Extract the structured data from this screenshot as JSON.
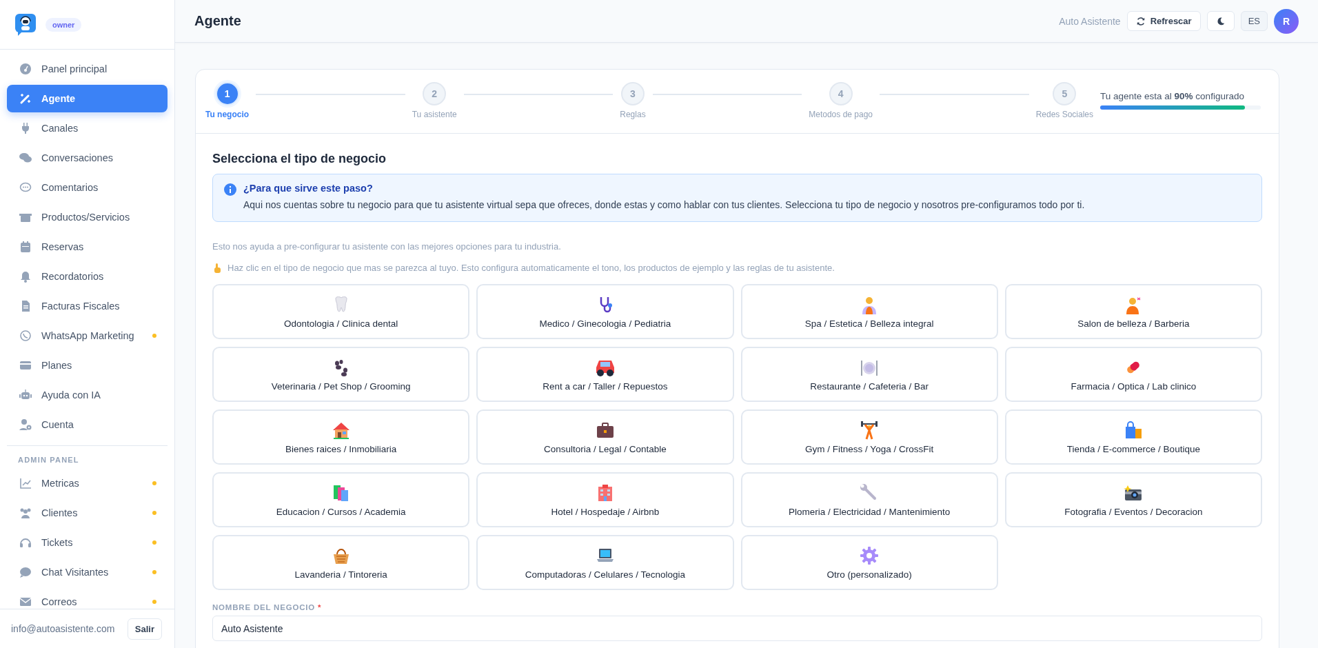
{
  "sidebar": {
    "role_badge": "owner",
    "items": [
      {
        "label": "Panel principal",
        "selected": false,
        "dot": false
      },
      {
        "label": "Agente",
        "selected": true,
        "dot": false
      },
      {
        "label": "Canales",
        "selected": false,
        "dot": false
      },
      {
        "label": "Conversaciones",
        "selected": false,
        "dot": false
      },
      {
        "label": "Comentarios",
        "selected": false,
        "dot": false
      },
      {
        "label": "Productos/Servicios",
        "selected": false,
        "dot": false
      },
      {
        "label": "Reservas",
        "selected": false,
        "dot": false
      },
      {
        "label": "Recordatorios",
        "selected": false,
        "dot": false
      },
      {
        "label": "Facturas Fiscales",
        "selected": false,
        "dot": false
      },
      {
        "label": "WhatsApp Marketing",
        "selected": false,
        "dot": true
      },
      {
        "label": "Planes",
        "selected": false,
        "dot": false
      },
      {
        "label": "Ayuda con IA",
        "selected": false,
        "dot": false
      },
      {
        "label": "Cuenta",
        "selected": false,
        "dot": false
      }
    ],
    "section_title": "ADMIN PANEL",
    "admin_items": [
      {
        "label": "Metricas",
        "selected": false,
        "dot": true
      },
      {
        "label": "Clientes",
        "selected": false,
        "dot": true
      },
      {
        "label": "Tickets",
        "selected": false,
        "dot": true
      },
      {
        "label": "Chat Visitantes",
        "selected": false,
        "dot": true
      },
      {
        "label": "Correos",
        "selected": false,
        "dot": true
      }
    ],
    "footer": {
      "email": "info@autoasistente.com",
      "logout": "Salir"
    }
  },
  "header": {
    "title": "Agente",
    "account": "Auto Asistente",
    "refresh": "Refrescar",
    "language": "ES",
    "avatar": "R"
  },
  "stepper": {
    "steps": [
      {
        "number": "1",
        "label": "Tu negocio",
        "selected": true
      },
      {
        "number": "2",
        "label": "Tu asistente",
        "selected": false
      },
      {
        "number": "3",
        "label": "Reglas",
        "selected": false
      },
      {
        "number": "4",
        "label": "Metodos de pago",
        "selected": false
      },
      {
        "number": "5",
        "label": "Redes Sociales",
        "selected": false
      }
    ],
    "progress": {
      "text": "Tu agente esta al **90%** configurado",
      "level": 0.9
    }
  },
  "section": {
    "title": "Selecciona el tipo de negocio",
    "info": {
      "title": "¿Para que sirve este paso?",
      "text": "Aqui nos cuentas sobre tu negocio para que tu asistente virtual sepa que ofreces, donde estas y como hablar con tus clientes. Selecciona tu tipo de negocio y nosotros pre-configuramos todo por ti."
    },
    "hint": "Esto nos ayuda a pre-configurar tu asistente con las mejores opciones para tu industria.",
    "instruction": "Haz clic en el tipo de negocio que mas se parezca al tuyo. Esto configura automaticamente el tono, los productos de ejemplo y las reglas de tu asistente."
  },
  "business_types": [
    {
      "label": "Odontologia / Clinica dental",
      "selected": false
    },
    {
      "label": "Medico / Ginecologia / Pediatria",
      "selected": false
    },
    {
      "label": "Spa / Estetica / Belleza integral",
      "selected": false
    },
    {
      "label": "Salon de belleza / Barberia",
      "selected": false
    },
    {
      "label": "Veterinaria / Pet Shop / Grooming",
      "selected": false
    },
    {
      "label": "Rent a car / Taller / Repuestos",
      "selected": false
    },
    {
      "label": "Restaurante / Cafeteria / Bar",
      "selected": false
    },
    {
      "label": "Farmacia / Optica / Lab clinico",
      "selected": false
    },
    {
      "label": "Bienes raices / Inmobiliaria",
      "selected": false
    },
    {
      "label": "Consultoria / Legal / Contable",
      "selected": false
    },
    {
      "label": "Gym / Fitness / Yoga / CrossFit",
      "selected": false
    },
    {
      "label": "Tienda / E-commerce / Boutique",
      "selected": false
    },
    {
      "label": "Educacion / Cursos / Academia",
      "selected": false
    },
    {
      "label": "Hotel / Hospedaje / Airbnb",
      "selected": false
    },
    {
      "label": "Plomeria / Electricidad / Mantenimiento",
      "selected": false
    },
    {
      "label": "Fotografia / Eventos / Decoracion",
      "selected": false
    },
    {
      "label": "Lavanderia / Tintoreria",
      "selected": false
    },
    {
      "label": "Computadoras / Celulares / Tecnologia",
      "selected": false
    },
    {
      "label": "Otro (personalizado)",
      "selected": false
    }
  ],
  "name_field": {
    "label": "NOMBRE DEL NEGOCIO",
    "required_mark": "*",
    "value": "Auto Asistente"
  }
}
